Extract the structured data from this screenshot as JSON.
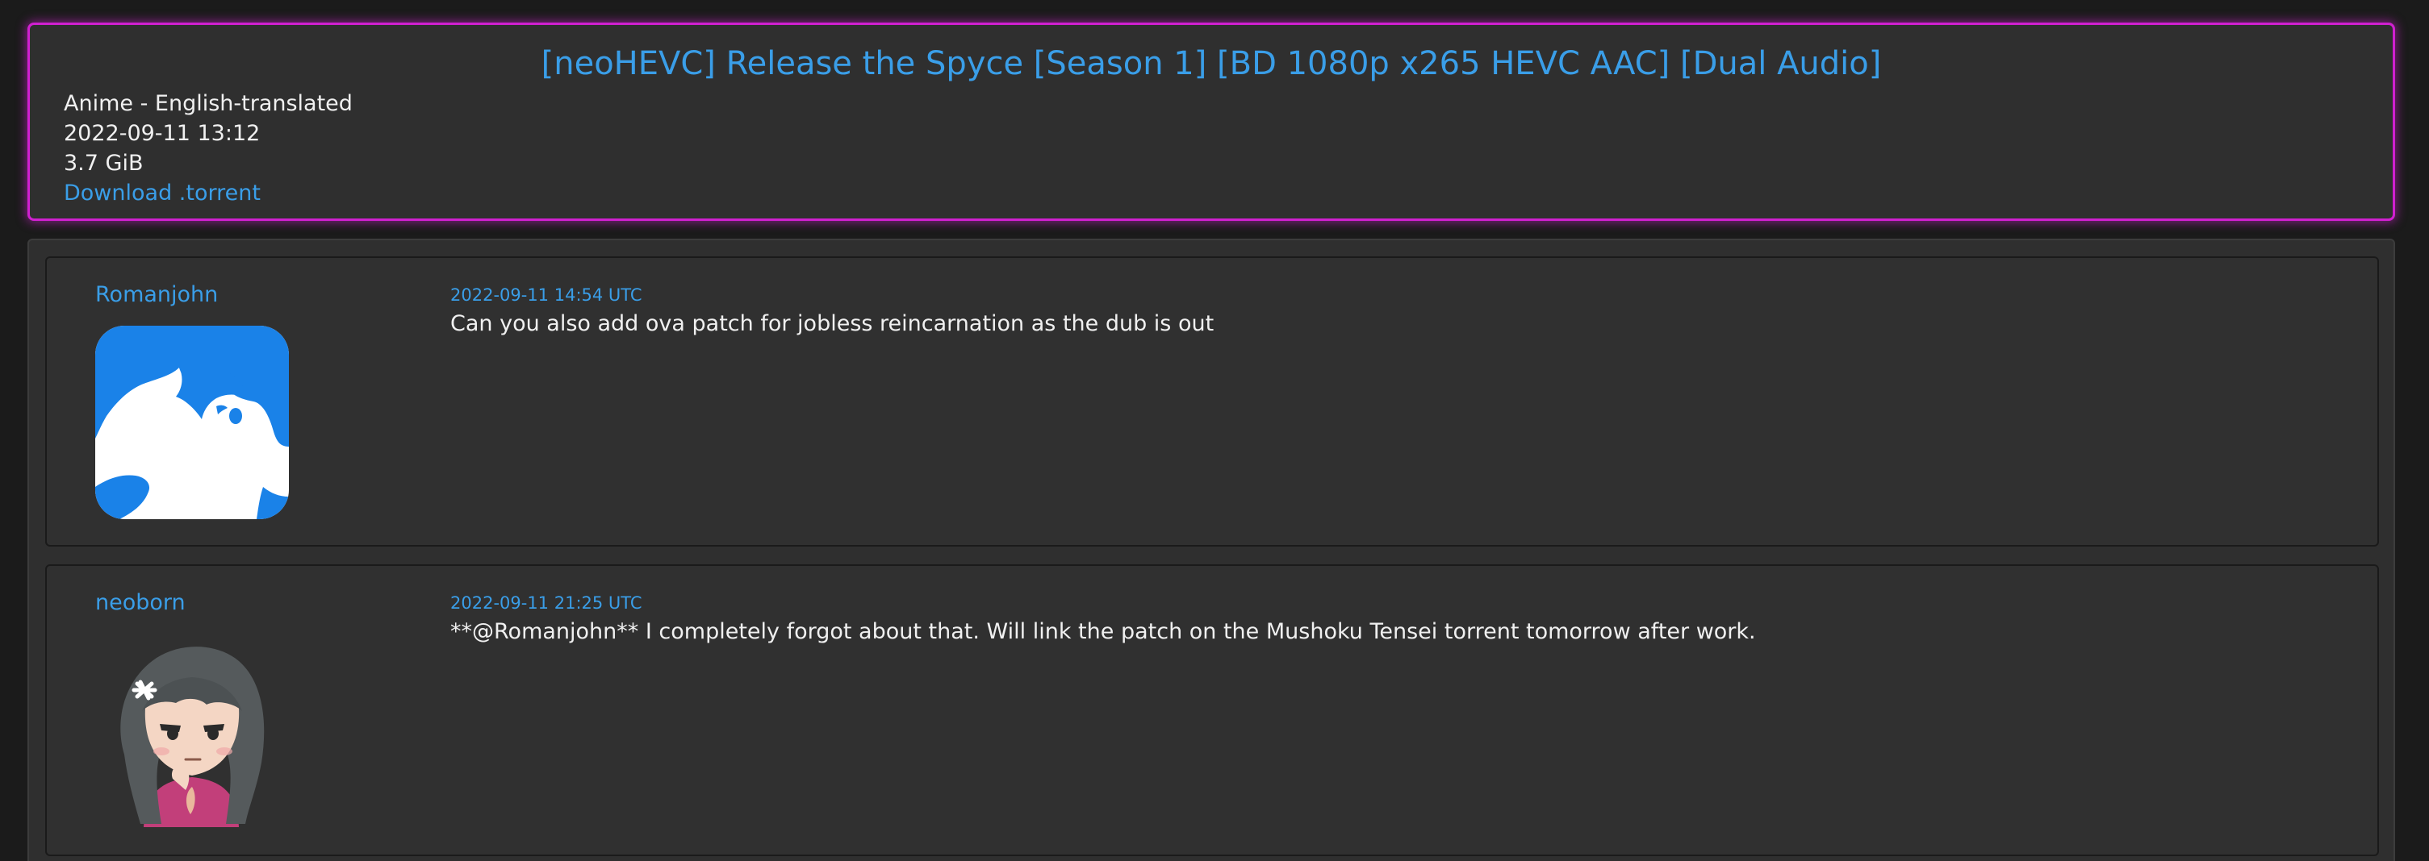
{
  "torrent": {
    "title": "[neoHEVC] Release the Spyce [Season 1] [BD 1080p x265 HEVC AAC] [Dual Audio]",
    "category": "Anime - English-translated",
    "date": "2022-09-11 13:12",
    "size": "3.7 GiB",
    "download_label": "Download .torrent"
  },
  "comments": [
    {
      "user": "Romanjohn",
      "timestamp": "2022-09-11 14:54 UTC",
      "text": "Can you also add ova patch for jobless reincarnation as the dub is out",
      "avatar_icon": "anime-silhouette-avatar"
    },
    {
      "user": "neoborn",
      "timestamp": "2022-09-11 21:25 UTC",
      "text": "**@Romanjohn** I completely forgot about that. Will link the patch on the Mushoku Tensei torrent tomorrow after work.",
      "avatar_icon": "anime-girl-avatar"
    }
  ],
  "colors": {
    "accent": "#3a9ee8",
    "header_border": "#d020d0",
    "panel": "#2f2f2f",
    "background": "#1b1b1b"
  }
}
